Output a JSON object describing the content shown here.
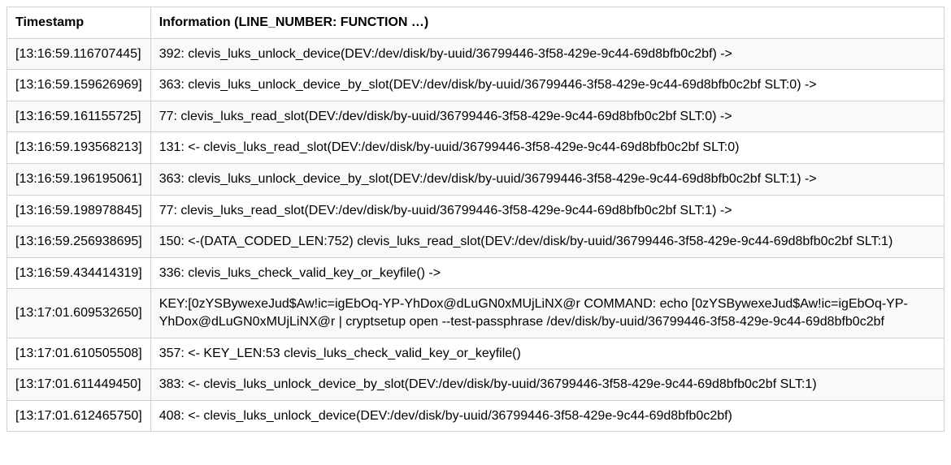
{
  "columns": {
    "timestamp": "Timestamp",
    "information": "Information (LINE_NUMBER: FUNCTION …)"
  },
  "rows": [
    {
      "timestamp": "[13:16:59.116707445]",
      "info": "392: clevis_luks_unlock_device(DEV:/dev/disk/by-uuid/36799446-3f58-429e-9c44-69d8bfb0c2bf) ->"
    },
    {
      "timestamp": "[13:16:59.159626969]",
      "info": "363: clevis_luks_unlock_device_by_slot(DEV:/dev/disk/by-uuid/36799446-3f58-429e-9c44-69d8bfb0c2bf SLT:0) ->"
    },
    {
      "timestamp": "[13:16:59.161155725]",
      "info": "77: clevis_luks_read_slot(DEV:/dev/disk/by-uuid/36799446-3f58-429e-9c44-69d8bfb0c2bf SLT:0) ->"
    },
    {
      "timestamp": "[13:16:59.193568213]",
      "info": "131: <- clevis_luks_read_slot(DEV:/dev/disk/by-uuid/36799446-3f58-429e-9c44-69d8bfb0c2bf SLT:0)"
    },
    {
      "timestamp": "[13:16:59.196195061]",
      "info": "363: clevis_luks_unlock_device_by_slot(DEV:/dev/disk/by-uuid/36799446-3f58-429e-9c44-69d8bfb0c2bf SLT:1) ->"
    },
    {
      "timestamp": "[13:16:59.198978845]",
      "info": "77: clevis_luks_read_slot(DEV:/dev/disk/by-uuid/36799446-3f58-429e-9c44-69d8bfb0c2bf SLT:1) ->"
    },
    {
      "timestamp": "[13:16:59.256938695]",
      "info": "150: <-(DATA_CODED_LEN:752) clevis_luks_read_slot(DEV:/dev/disk/by-uuid/36799446-3f58-429e-9c44-69d8bfb0c2bf SLT:1)"
    },
    {
      "timestamp": "[13:16:59.434414319]",
      "info": "336: clevis_luks_check_valid_key_or_keyfile() ->"
    },
    {
      "timestamp": "[13:17:01.609532650]",
      "info": "KEY:[0zYSBywexeJud$Aw!ic=igEbOq-YP-YhDox@dLuGN0xMUjLiNX@r COMMAND: echo [0zYSBywexeJud$Aw!ic=igEbOq-YP-YhDox@dLuGN0xMUjLiNX@r | cryptsetup open --test-passphrase /dev/disk/by-uuid/36799446-3f58-429e-9c44-69d8bfb0c2bf"
    },
    {
      "timestamp": "[13:17:01.610505508]",
      "info": "357: <- KEY_LEN:53 clevis_luks_check_valid_key_or_keyfile()"
    },
    {
      "timestamp": "[13:17:01.611449450]",
      "info": "383: <- clevis_luks_unlock_device_by_slot(DEV:/dev/disk/by-uuid/36799446-3f58-429e-9c44-69d8bfb0c2bf SLT:1)"
    },
    {
      "timestamp": "[13:17:01.612465750]",
      "info": "408: <- clevis_luks_unlock_device(DEV:/dev/disk/by-uuid/36799446-3f58-429e-9c44-69d8bfb0c2bf)"
    }
  ]
}
